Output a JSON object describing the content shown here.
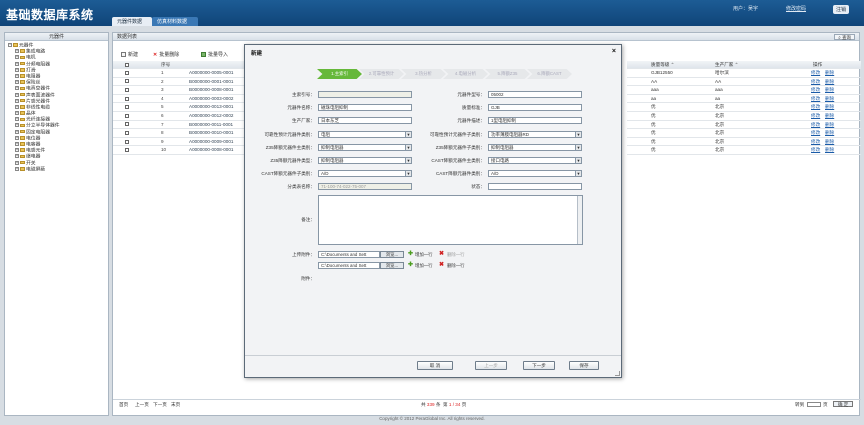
{
  "header": {
    "title": "基础数据库系统",
    "tabs": [
      "元器件数据",
      "仿真材料数据"
    ],
    "user": "用户：吴宇",
    "password_link": "修改密码",
    "logout": "注销"
  },
  "sidebar": {
    "title": "元器件",
    "root": "元器件",
    "items": [
      "集成电路",
      "电机",
      "分频电阻器",
      "打滑",
      "电阻器",
      "保险丝",
      "电真空器件",
      "声表面波器件",
      "片感光器件",
      "非线性电缆",
      "晶体",
      "光纤连接器",
      "分立半导体器件",
      "固定电阻器",
      "电位器",
      "电容器",
      "电感元件",
      "继电器",
      "开关",
      "电磁屏蔽"
    ]
  },
  "main": {
    "title": "数据列表",
    "search_button": "查询",
    "toolbar": {
      "new": "新建",
      "batch_delete": "批量删除",
      "batch_import": "批量导入"
    },
    "col_seq": "序号",
    "col_quality": "质量等级",
    "col_maker": "生产厂家",
    "col_ops": "操作",
    "rows": [
      {
        "seq": "1",
        "code": "A0000000-0005-0001",
        "quality": "GJB12550",
        "maker": "哈尔滨"
      },
      {
        "seq": "2",
        "code": "B0000000-0001-0001",
        "quality": "AA",
        "maker": "AA"
      },
      {
        "seq": "3",
        "code": "B0000000-0008-0001",
        "quality": "aaa",
        "maker": "aaa"
      },
      {
        "seq": "4",
        "code": "A0000000-0003-0002",
        "quality": "aa",
        "maker": "aa"
      },
      {
        "seq": "5",
        "code": "A0000000-0013-0001",
        "quality": "优",
        "maker": "北京"
      },
      {
        "seq": "6",
        "code": "A0000000-0012-0002",
        "quality": "优",
        "maker": "北京"
      },
      {
        "seq": "7",
        "code": "B0000000-0011-0001",
        "quality": "优",
        "maker": "北京"
      },
      {
        "seq": "8",
        "code": "B0000000-0010-0001",
        "quality": "优",
        "maker": "北京"
      },
      {
        "seq": "9",
        "code": "A0000000-0009-0001",
        "quality": "优",
        "maker": "北京"
      },
      {
        "seq": "10",
        "code": "A0000000-0008-0001",
        "quality": "优",
        "maker": "北京"
      }
    ],
    "op_edit": "修改",
    "op_delete": "删除",
    "pager": {
      "first": "首页",
      "prev": "上一页",
      "next": "下一页",
      "last": "末页",
      "total_prefix": "共",
      "total": "339",
      "total_suffix": "条",
      "page_prefix": "第",
      "page": "1 / 34",
      "page_suffix": "页",
      "goto": "转到",
      "goto_page": "页",
      "confirm": "确 定"
    }
  },
  "footer": "Copyright © 2012 PeraGlobal Inc. All rights reserved.",
  "dialog": {
    "title": "新建",
    "steps": [
      "1.主索引",
      "2.可靠性预计",
      "3.热分析",
      "4.电磁分析",
      "5.降额Z35",
      "6.降额CAST"
    ],
    "fields": {
      "index_label": "主索引号：",
      "index_value": "",
      "model_label": "元器件型号：",
      "model_value": "05002",
      "name_label": "元器件名称：",
      "name_value": "磁珠电阻抑制",
      "std_label": "质量标准：",
      "std_value": "GJB",
      "maker_label": "生产厂家：",
      "maker_value": "日本东芝",
      "desc_label": "元器件描述：",
      "desc_value": "1型电阻抑制",
      "rel_main_label": "可靠性预计元器件类别：",
      "rel_main_value": "电阻",
      "rel_sub_label": "可靠性预计元器件子类别：",
      "rel_sub_value": "功率薄膜电阻器RD",
      "z35_main_label": "Z35降额元器件主类别：",
      "z35_main_value": "抑制电阻器",
      "z35_sub_label": "Z35降额元器件子类别：",
      "z35_sub_value": "抑制电阻器",
      "cast_type_label": "Z35降额元器件类型：",
      "cast_type_value": "抑制电阻器",
      "cast_main_label": "CAST降额元器件主类别：",
      "cast_main_value": "接口电路",
      "cast_sub_label": "CAST降额元器件子类别：",
      "cast_sub_value": "A/D",
      "cast_kind_label": "CAST降额元器件类别：",
      "cast_kind_value": "A/D",
      "class_label": "分类表名称：",
      "class_value": "71-100-74-022-75-007",
      "state_label": "状态：",
      "state_value": "",
      "remark_label": "备注：",
      "upload_label": "上传附件：",
      "file1": "C:\\Documents and Sett",
      "file2": "C:\\Documents and Sett",
      "browse": "浏览...",
      "add_row": "增加一行",
      "del_row": "删除一行",
      "attach_label": "附件："
    },
    "buttons": {
      "cancel": "取 消",
      "prev": "上一步",
      "next": "下一步",
      "save": "保存"
    }
  }
}
